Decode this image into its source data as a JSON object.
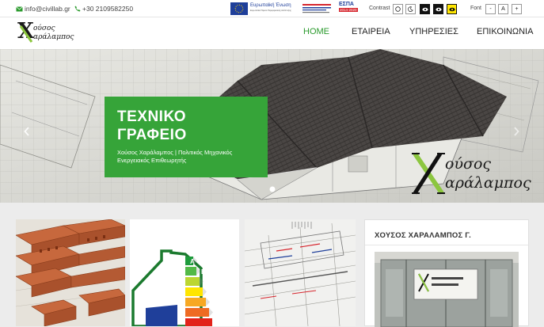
{
  "topbar": {
    "email": "info@civillab.gr",
    "phone": "+30 2109582250",
    "eu_text": "Ευρωπαϊκή Ένωση",
    "eu_subtext": "Ευρωπαϊκό Ταμείο Περιφερειακής Ανάπτυξης",
    "espa_text": "ΕΣΠΑ",
    "espa_years": "2014-2020",
    "contrast_label": "Contrast",
    "font_label": "Font",
    "font_buttons": [
      "-",
      "A",
      "+"
    ]
  },
  "header": {
    "logo_letter": "X",
    "logo_line1": "ούσος",
    "logo_line2": "αράλαμπος"
  },
  "nav": {
    "items": [
      {
        "label": "HOME",
        "active": true
      },
      {
        "label": "ΕΤΑΙΡΕΙΑ",
        "active": false
      },
      {
        "label": "ΥΠΗΡΕΣΙΕΣ",
        "active": false
      },
      {
        "label": "ΕΠΙΚΟΙΝΩΝΙΑ",
        "active": false
      }
    ]
  },
  "hero": {
    "title_line1": "ΤΕΧΝΙΚΟ",
    "title_line2": "ΓΡΑΦΕΙΟ",
    "subtitle_line1": "Χούσος Χαράλαμπος | Πολιτικός Μηχανικός",
    "subtitle_line2": "Ενεργειακός Επιθεωρητής",
    "logo_line1": "ούσος",
    "logo_line2": "αράλαμπος",
    "prev_arrow": "‹",
    "next_arrow": "›"
  },
  "energy_labels": [
    "A",
    "B",
    "C",
    "D",
    "E",
    "F"
  ],
  "side_panel": {
    "title": "ΧΟΥΣΟΣ ΧΑΡΑΛΑΜΠΟΣ Γ."
  },
  "colors": {
    "accent_green": "#36a439",
    "nav_active": "#2a9a2c",
    "logo_green": "#8cc63f"
  }
}
